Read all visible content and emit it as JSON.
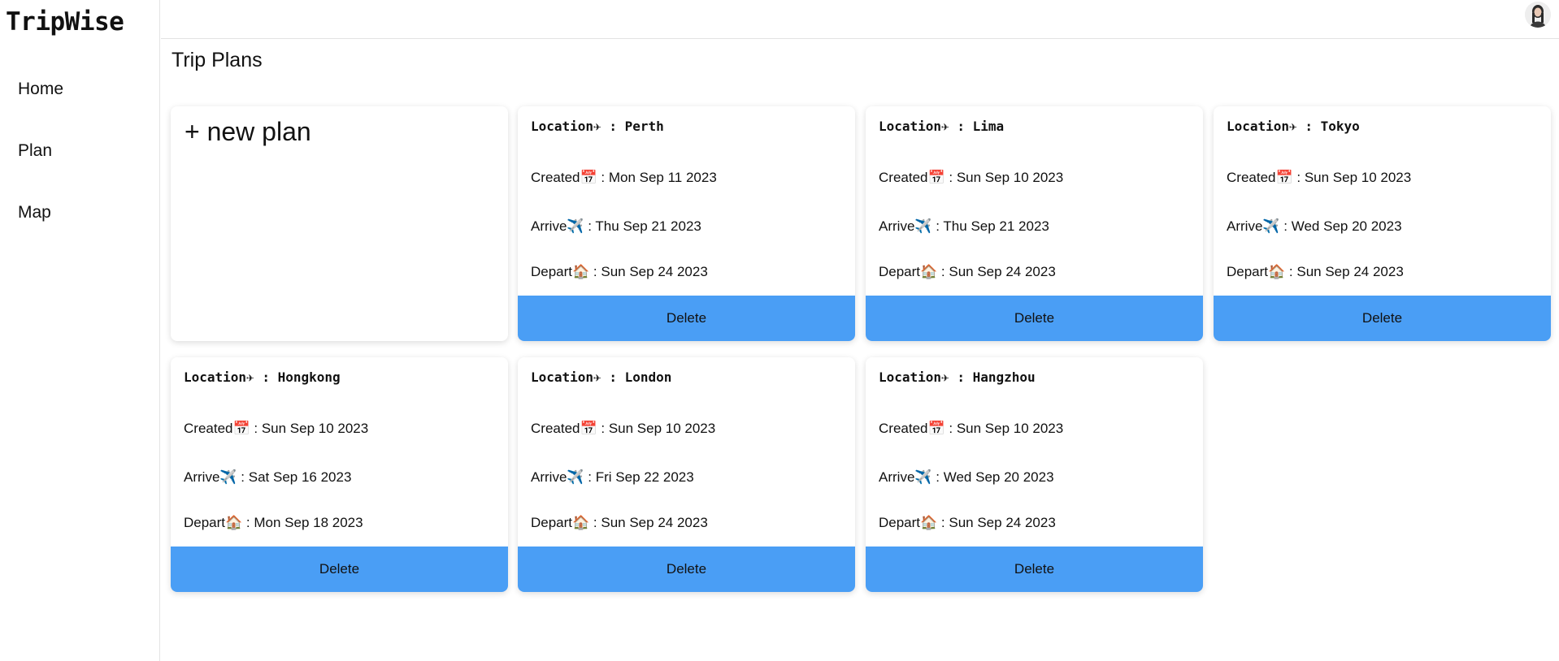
{
  "app": {
    "brand": "TripWise"
  },
  "sidebar": {
    "items": [
      {
        "label": "Home"
      },
      {
        "label": "Plan"
      },
      {
        "label": "Map"
      }
    ]
  },
  "main": {
    "title": "Trip Plans",
    "new_plan_label": "+ new plan",
    "labels": {
      "location": "Location✈ : ",
      "created": "Created📅 : ",
      "arrive": "Arrive✈️ : ",
      "depart": "Depart🏠 : ",
      "delete": "Delete"
    },
    "plans": [
      {
        "location": "Perth",
        "created": "Mon Sep 11 2023",
        "arrive": "Thu Sep 21 2023",
        "depart": "Sun Sep 24 2023"
      },
      {
        "location": "Lima",
        "created": "Sun Sep 10 2023",
        "arrive": "Thu Sep 21 2023",
        "depart": "Sun Sep 24 2023"
      },
      {
        "location": "Tokyo",
        "created": "Sun Sep 10 2023",
        "arrive": "Wed Sep 20 2023",
        "depart": "Sun Sep 24 2023"
      },
      {
        "location": "Hongkong",
        "created": "Sun Sep 10 2023",
        "arrive": "Sat Sep 16 2023",
        "depart": "Mon Sep 18 2023"
      },
      {
        "location": "London",
        "created": "Sun Sep 10 2023",
        "arrive": "Fri Sep 22 2023",
        "depart": "Sun Sep 24 2023"
      },
      {
        "location": "Hangzhou",
        "created": "Sun Sep 10 2023",
        "arrive": "Wed Sep 20 2023",
        "depart": "Sun Sep 24 2023"
      }
    ]
  }
}
